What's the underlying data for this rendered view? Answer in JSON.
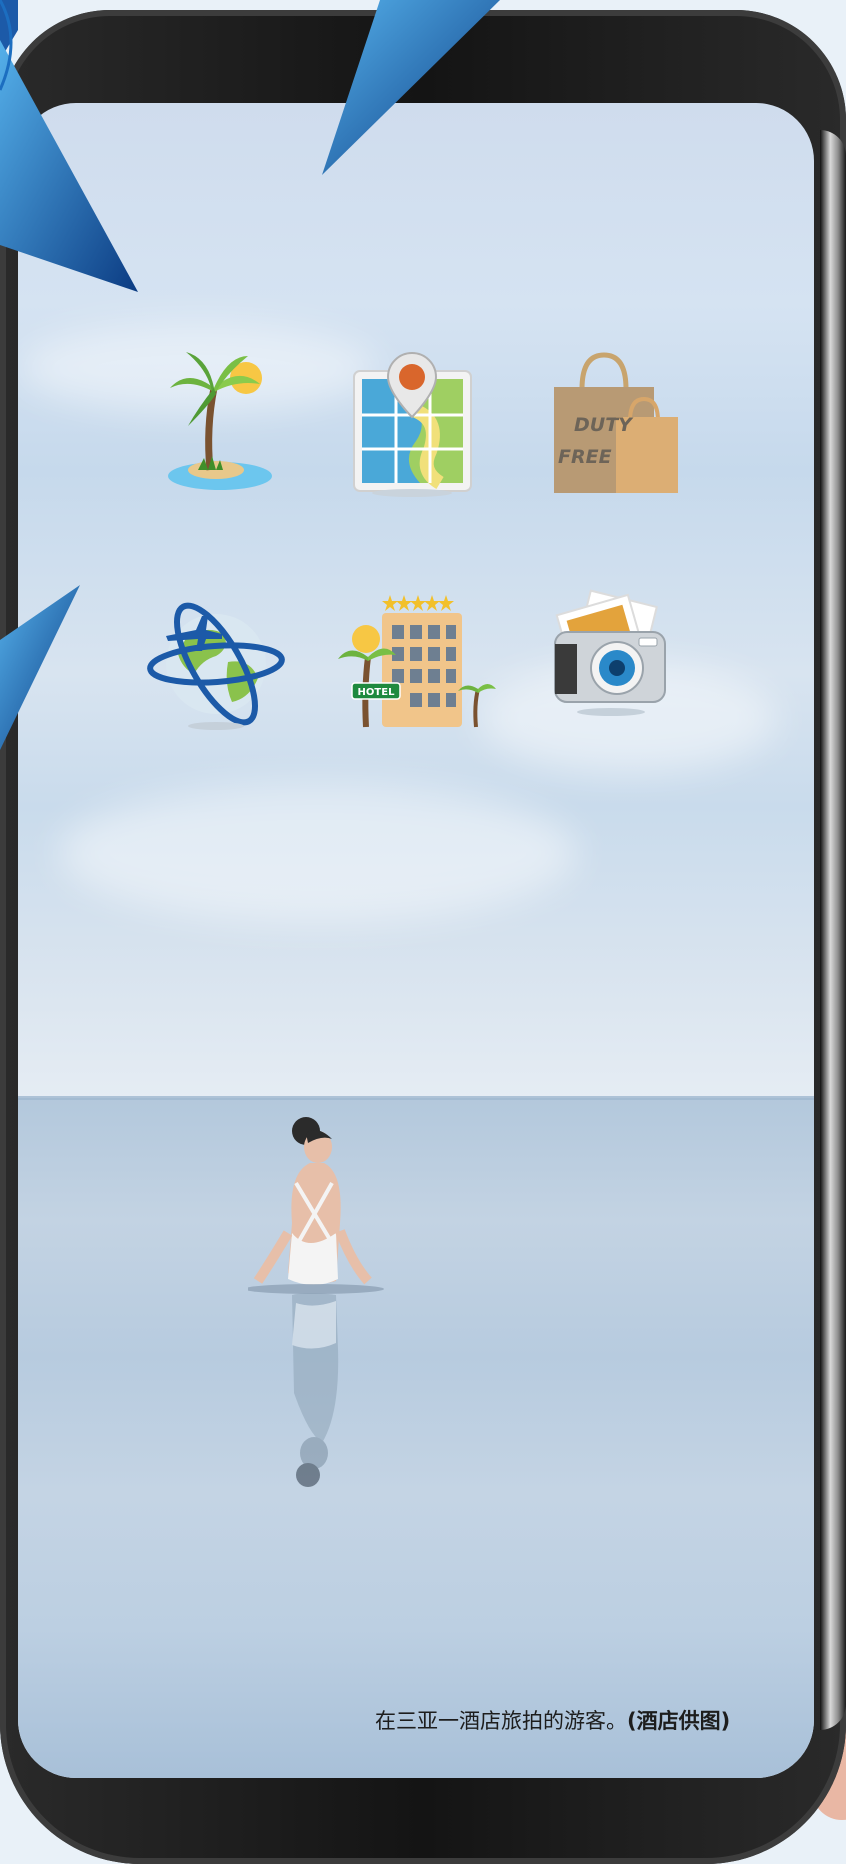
{
  "caption": {
    "main": "在三亚一酒店旅拍的游客。",
    "credit": "(酒店供图)"
  },
  "icons": [
    {
      "name": "palm-island-icon"
    },
    {
      "name": "map-pin-icon"
    },
    {
      "name": "duty-free-bags-icon",
      "text1": "DUTY",
      "text2": "FREE"
    },
    {
      "name": "globe-plane-icon"
    },
    {
      "name": "hotel-building-icon",
      "sign": "HOTEL"
    },
    {
      "name": "camera-photos-icon"
    }
  ],
  "colors": {
    "accent_blue": "#1c5aa8",
    "phone_body": "#1a1a1a",
    "sky": "#d5e3f2",
    "sea": "#bccfe2"
  }
}
